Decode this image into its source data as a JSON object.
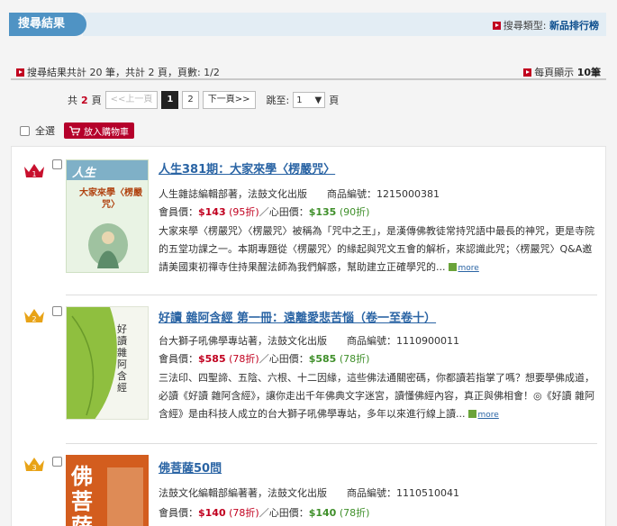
{
  "header": {
    "tab_label": "搜尋結果",
    "type_label": "搜尋類型:",
    "type_value": "新品排行榜"
  },
  "summary": {
    "text": "搜尋結果共計 20 筆，共計 2 頁，頁數:  1/2",
    "per_page_label": "每頁顯示",
    "per_page_value": "10筆"
  },
  "pager": {
    "total_prefix": "共",
    "total_pages": "2",
    "total_suffix": "頁",
    "prev": "<<上一頁",
    "pages": [
      "1",
      "2"
    ],
    "current": "1",
    "next": "下一頁>>",
    "jump_label": "跳至:",
    "jump_value": "1",
    "jump_suffix": "頁"
  },
  "actions": {
    "select_all": "全選",
    "add_to_cart": "放入購物車"
  },
  "items": [
    {
      "rank": "1",
      "title": "人生381期：大家來學〈楞嚴咒〉",
      "author": "人生雜誌編輯部著，法鼓文化出版",
      "sku_label": "商品編號：",
      "sku": "1215000381",
      "member_label": "會員價：",
      "member_price": "$143",
      "member_disc": "(95折)",
      "heart_label": "／心田價：",
      "heart_price": "$135",
      "heart_disc": "(90折)",
      "desc": "大家來學〈楞嚴咒〉〈楞嚴咒〉被稱為「咒中之王」，是漢傳佛教徒常持咒語中最長的神咒，更是寺院的五堂功課之一。本期專題從〈楞嚴咒〉的緣起與咒文五會的解析，來認識此咒；〈楞嚴咒〉Q&A邀請美國東初禪寺住持果醒法師為我們解惑，幫助建立正確學咒的...",
      "more": "more",
      "cover_title": "大家來學〈楞嚴咒〉",
      "cover_logo": "人生"
    },
    {
      "rank": "2",
      "title": "好讀 雜阿含經 第一冊：遠離愛悲苦惱（卷一至卷十）",
      "author": "台大獅子吼佛學專站著，法鼓文化出版",
      "sku_label": "商品編號：",
      "sku": "1110900011",
      "member_label": "會員價：",
      "member_price": "$585",
      "member_disc": "(78折)",
      "heart_label": "／心田價：",
      "heart_price": "$585",
      "heart_disc": "(78折)",
      "desc": "三法印、四聖諦、五陰、六根、十二因緣，這些佛法通關密碼，你都讀若指掌了嗎？想要學佛成道，必讀《好讀 雜阿含經》，讓你走出千年佛典文字迷宮，讀懂佛經內容，真正與佛相會！◎《好讀 雜阿含經》是由科技人成立的台大獅子吼佛學專站，多年以來進行線上讀...",
      "more": "more",
      "cover_title": "好讀 雜阿含經"
    },
    {
      "rank": "3",
      "title": "佛菩薩50問",
      "author": "法鼓文化編輯部編著著，法鼓文化出版",
      "sku_label": "商品編號：",
      "sku": "1110510041",
      "member_label": "會員價：",
      "member_price": "$140",
      "member_disc": "(78折)",
      "heart_label": "／心田價：",
      "heart_price": "$140",
      "heart_disc": "(78折)",
      "cover_title": "佛菩薩"
    }
  ],
  "colors": {
    "accent_blue": "#4f93c4",
    "title_blue": "#2a64a4",
    "price_red": "#c1001f",
    "price_green": "#3f8f2a",
    "crown_gold": "#e8a317",
    "crown_red": "#c8102e"
  },
  "icons": {
    "rank": "crown-icon",
    "cart": "cart-icon",
    "bullet": "red-arrow-square-icon"
  }
}
